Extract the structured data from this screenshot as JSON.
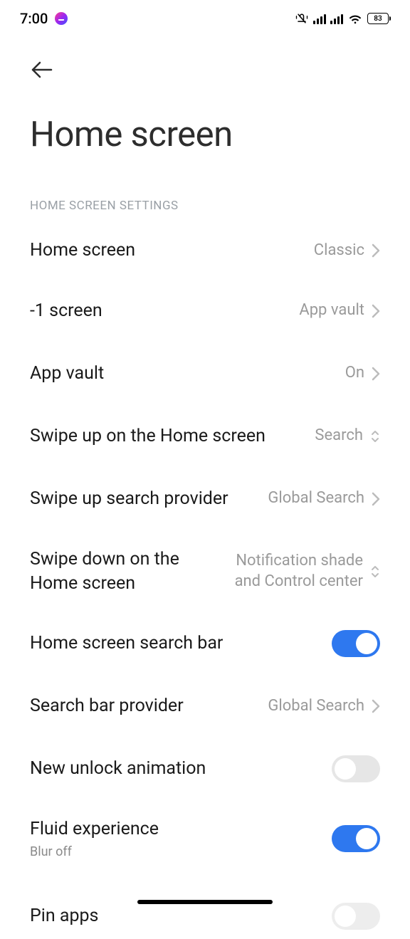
{
  "status": {
    "time": "7:00",
    "battery": "83"
  },
  "header": {
    "title": "Home screen"
  },
  "section": {
    "title": "HOME SCREEN SETTINGS"
  },
  "settings": {
    "homescreen": {
      "label": "Home screen",
      "value": "Classic"
    },
    "minus1": {
      "label": "-1 screen",
      "value": "App vault"
    },
    "appvault": {
      "label": "App vault",
      "value": "On"
    },
    "swipeup": {
      "label": "Swipe up on the Home screen",
      "value": "Search"
    },
    "swipeup_provider": {
      "label": "Swipe up search provider",
      "value": "Global Search"
    },
    "swipedown": {
      "label": "Swipe down on the Home screen",
      "value": "Notification shade and Control center"
    },
    "searchbar": {
      "label": "Home screen search bar",
      "on": true
    },
    "searchbar_provider": {
      "label": "Search bar provider",
      "value": "Global Search"
    },
    "unlock_anim": {
      "label": "New unlock animation",
      "on": false
    },
    "fluid": {
      "label": "Fluid experience",
      "sub": "Blur off",
      "on": true
    },
    "pin": {
      "label": "Pin apps",
      "on": false
    }
  }
}
